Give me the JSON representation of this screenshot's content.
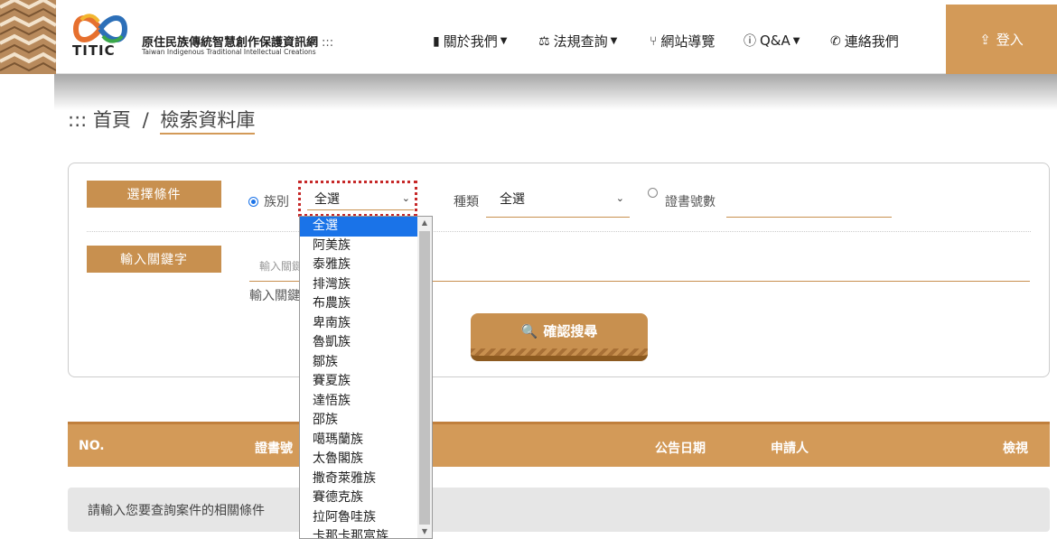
{
  "header": {
    "logo_text": "TITIC",
    "site_title": "原住民族傳統智慧創作保護資訊網",
    "title_dots": ":::",
    "site_subtitle": "Taiwan Indigenous Traditional Intellectual Creations",
    "nav": [
      {
        "label": "關於我們",
        "icon": "bookmark-icon",
        "has_caret": true
      },
      {
        "label": "法規查詢",
        "icon": "scale-icon",
        "has_caret": true
      },
      {
        "label": "網站導覽",
        "icon": "branch-icon",
        "has_caret": false
      },
      {
        "label": "Q&A",
        "icon": "question-icon",
        "has_caret": true
      },
      {
        "label": "連絡我們",
        "icon": "phone-icon",
        "has_caret": false
      }
    ],
    "login_label": "登入",
    "accent": "#d39a58"
  },
  "breadcrumb": {
    "prefix": ":::",
    "home": "首頁",
    "separator": "/",
    "current": "檢索資料庫"
  },
  "search": {
    "condition_label": "選擇條件",
    "tribe_label": "族別",
    "tribe_value": "全選",
    "type_label": "種類",
    "type_value": "全選",
    "cert_label": "證書號數",
    "keyword_label": "輸入關鍵字",
    "keyword_placeholder": "輸入關鍵",
    "keyword_hint": "輸入關鍵",
    "submit_label": "確認搜尋"
  },
  "table": {
    "headers": {
      "no": "NO.",
      "cert": "證書號",
      "date": "公告日期",
      "applicant": "申請人",
      "view": "檢視"
    },
    "empty_message": "請輸入您要查詢案件的相關條件"
  },
  "tribe_options": [
    "全選",
    "阿美族",
    "泰雅族",
    "排灣族",
    "布農族",
    "卑南族",
    "魯凱族",
    "鄒族",
    "賽夏族",
    "達悟族",
    "邵族",
    "噶瑪蘭族",
    "太魯閣族",
    "撒奇萊雅族",
    "賽德克族",
    "拉阿魯哇族",
    "卡那卡那富族"
  ]
}
